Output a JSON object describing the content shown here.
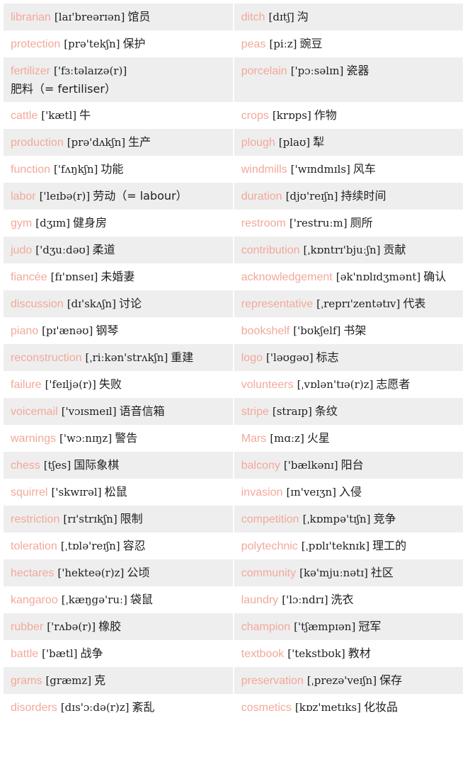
{
  "rows": [
    [
      {
        "word": "librarian",
        "phonetic": "[laɪ'breərɪən]",
        "meaning": "馆员"
      },
      {
        "word": "ditch",
        "phonetic": "[dɪtʃ]",
        "meaning": "沟"
      }
    ],
    [
      {
        "word": "protection",
        "phonetic": "[prə'tekʃn]",
        "meaning": "保护"
      },
      {
        "word": "peas",
        "phonetic": "[piːz]",
        "meaning": "豌豆"
      }
    ],
    [
      {
        "word": "fertilizer",
        "phonetic": "['fɜːtəlaɪzə(r)]",
        "meaning": "肥料（= fertiliser）"
      },
      {
        "word": "porcelain",
        "phonetic": "['pɔːsəlɪn]",
        "meaning": "瓷器"
      }
    ],
    [
      {
        "word": "cattle",
        "phonetic": "['kætl]",
        "meaning": "牛"
      },
      {
        "word": "crops",
        "phonetic": "[krɒps]",
        "meaning": "作物"
      }
    ],
    [
      {
        "word": "production",
        "phonetic": "[prə'dʌkʃn]",
        "meaning": "生产"
      },
      {
        "word": "plough",
        "phonetic": "[plaʊ]",
        "meaning": "犁"
      }
    ],
    [
      {
        "word": "function",
        "phonetic": "['fʌŋkʃn]",
        "meaning": "功能"
      },
      {
        "word": "windmills",
        "phonetic": "['wɪndmɪls]",
        "meaning": "风车"
      }
    ],
    [
      {
        "word": "labor",
        "phonetic": "['leɪbə(r)]",
        "meaning": "劳动（= labour）"
      },
      {
        "word": "duration",
        "phonetic": "[djʊ'reɪʃn]",
        "meaning": "持续时间"
      }
    ],
    [
      {
        "word": "gym",
        "phonetic": "[dʒɪm]",
        "meaning": "健身房"
      },
      {
        "word": "restroom",
        "phonetic": "['restruːm]",
        "meaning": "厕所"
      }
    ],
    [
      {
        "word": "judo",
        "phonetic": "['dʒuːdəʊ]",
        "meaning": "柔道"
      },
      {
        "word": "contribution",
        "phonetic": "[ˌkɒntrɪ'bjuːʃn]",
        "meaning": "贡献"
      }
    ],
    [
      {
        "word": "fiancée",
        "phonetic": "[fɪ'ɒnseɪ]",
        "meaning": "未婚妻"
      },
      {
        "word": "acknowledgement",
        "phonetic": "[ək'nɒlɪdʒmənt]",
        "meaning": "确认"
      }
    ],
    [
      {
        "word": "discussion",
        "phonetic": "[dɪ'skʌʃn]",
        "meaning": "讨论"
      },
      {
        "word": "representative",
        "phonetic": "[ˌreprɪ'zentətɪv]",
        "meaning": "代表"
      }
    ],
    [
      {
        "word": "piano",
        "phonetic": "[pɪ'ænəʊ]",
        "meaning": "钢琴"
      },
      {
        "word": "bookshelf",
        "phonetic": "['bʊkʃelf]",
        "meaning": "书架"
      }
    ],
    [
      {
        "word": "reconstruction",
        "phonetic": "[ˌriːkən'strʌkʃn]",
        "meaning": "重建"
      },
      {
        "word": "logo",
        "phonetic": "['ləʊgəʊ]",
        "meaning": "标志"
      }
    ],
    [
      {
        "word": "failure",
        "phonetic": "['feɪljə(r)]",
        "meaning": "失败"
      },
      {
        "word": "volunteers",
        "phonetic": "[ˌvɒlən'tɪə(r)z]",
        "meaning": "志愿者"
      }
    ],
    [
      {
        "word": "voicemail",
        "phonetic": "['vɔɪsmeɪl]",
        "meaning": "语音信箱"
      },
      {
        "word": "stripe",
        "phonetic": "[straɪp]",
        "meaning": "条纹"
      }
    ],
    [
      {
        "word": "warnings",
        "phonetic": "['wɔːnɪŋz]",
        "meaning": "警告"
      },
      {
        "word": "Mars",
        "phonetic": "[mɑːz]",
        "meaning": "火星"
      }
    ],
    [
      {
        "word": "chess",
        "phonetic": "[tʃes]",
        "meaning": "国际象棋"
      },
      {
        "word": "balcony",
        "phonetic": "['bælkənɪ]",
        "meaning": "阳台"
      }
    ],
    [
      {
        "word": "squirrel",
        "phonetic": "['skwɪrəl]",
        "meaning": "松鼠"
      },
      {
        "word": "invasion",
        "phonetic": "[ɪn'veɪʒn]",
        "meaning": "入侵"
      }
    ],
    [
      {
        "word": "restriction",
        "phonetic": "[rɪ'strɪkʃn]",
        "meaning": "限制"
      },
      {
        "word": "competition",
        "phonetic": "[ˌkɒmpə'tɪʃn]",
        "meaning": "竞争"
      }
    ],
    [
      {
        "word": "toleration",
        "phonetic": "[ˌtɒlə'reɪʃn]",
        "meaning": "容忍"
      },
      {
        "word": "polytechnic",
        "phonetic": "[ˌpɒlɪ'teknɪk]",
        "meaning": "理工的"
      }
    ],
    [
      {
        "word": "hectares",
        "phonetic": "['hekteə(r)z]",
        "meaning": "公顷"
      },
      {
        "word": "community",
        "phonetic": "[kə'mjuːnətɪ]",
        "meaning": "社区"
      }
    ],
    [
      {
        "word": "kangaroo",
        "phonetic": "[ˌkæŋgə'ruː]",
        "meaning": "袋鼠"
      },
      {
        "word": "laundry",
        "phonetic": "['lɔːndrɪ]",
        "meaning": "洗衣"
      }
    ],
    [
      {
        "word": "rubber",
        "phonetic": "['rʌbə(r)]",
        "meaning": "橡胶"
      },
      {
        "word": "champion",
        "phonetic": "['tʃæmpɪən]",
        "meaning": "冠军"
      }
    ],
    [
      {
        "word": "battle",
        "phonetic": "['bætl]",
        "meaning": "战争"
      },
      {
        "word": "textbook",
        "phonetic": "['tekstbʊk]",
        "meaning": "教材"
      }
    ],
    [
      {
        "word": "grams",
        "phonetic": "[græmz]",
        "meaning": "克"
      },
      {
        "word": "preservation",
        "phonetic": "[ˌprezə'veɪʃn]",
        "meaning": "保存"
      }
    ],
    [
      {
        "word": "disorders",
        "phonetic": "[dɪs'ɔːdə(r)z]",
        "meaning": "紊乱"
      },
      {
        "word": "cosmetics",
        "phonetic": "[kɒz'metɪks]",
        "meaning": "化妆品"
      }
    ]
  ]
}
